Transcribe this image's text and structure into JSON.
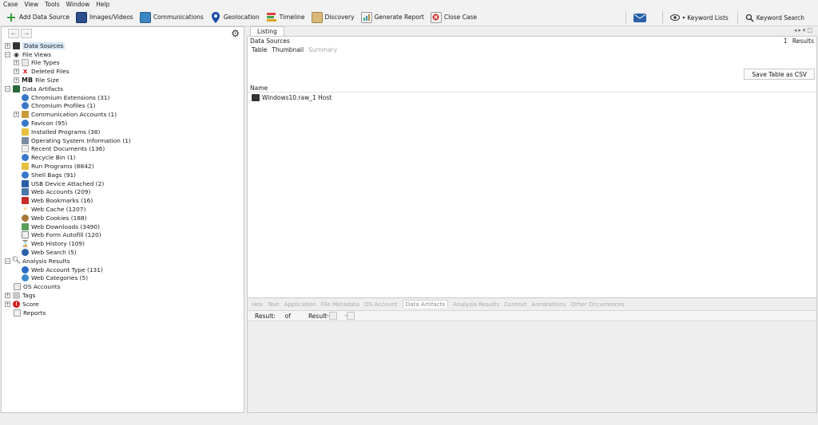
{
  "menu": [
    "Case",
    "View",
    "Tools",
    "Window",
    "Help"
  ],
  "toolbar": {
    "add_data_source": "Add Data Source",
    "images_videos": "Images/Videos",
    "communications": "Communications",
    "geolocation": "Geolocation",
    "timeline": "Timeline",
    "discovery": "Discovery",
    "generate_report": "Generate Report",
    "close_case": "Close Case",
    "keyword_lists": "Keyword Lists",
    "keyword_search": "Keyword Search"
  },
  "tree": {
    "data_sources": "Data Sources",
    "file_views": "File Views",
    "file_types": "File Types",
    "deleted_files": "Deleted Files",
    "file_size_prefix": "MB",
    "file_size": "File Size",
    "data_artifacts": "Data Artifacts",
    "artifacts": [
      "Chromium Extensions (31)",
      "Chromium Profiles (1)",
      "Communication Accounts (1)",
      "Favicon (95)",
      "Installed Programs (38)",
      "Operating System Information (1)",
      "Recent Documents (136)",
      "Recycle Bin (1)",
      "Run Programs (8842)",
      "Shell Bags (91)",
      "USB Device Attached (2)",
      "Web Accounts (209)",
      "Web Bookmarks (16)",
      "Web Cache (1207)",
      "Web Cookies (188)",
      "Web Downloads (3490)",
      "Web Form Autofill (120)",
      "Web History (109)",
      "Web Search (5)"
    ],
    "analysis_results": "Analysis Results",
    "analysis": [
      "Web Account Type (131)",
      "Web Categories (5)"
    ],
    "os_accounts": "OS Accounts",
    "tags": "Tags",
    "score": "Score",
    "reports": "Reports"
  },
  "listing": {
    "tab": "Listing",
    "title": "Data Sources",
    "results_count": "1",
    "results_label": "Results",
    "subtabs": [
      "Table",
      "Thumbnail",
      "Summary"
    ],
    "save_csv": "Save Table as CSV",
    "column_name": "Name",
    "rows": [
      "Windows10.raw_1 Host"
    ]
  },
  "content_viewer": {
    "tabs": [
      "Hex",
      "Text",
      "Application",
      "File Metadata",
      "OS Account",
      "Data Artifacts",
      "Analysis Results",
      "Context",
      "Annotations",
      "Other Occurrences"
    ],
    "result_label": "Result:",
    "of_label": "of",
    "result2_label": "Result"
  }
}
